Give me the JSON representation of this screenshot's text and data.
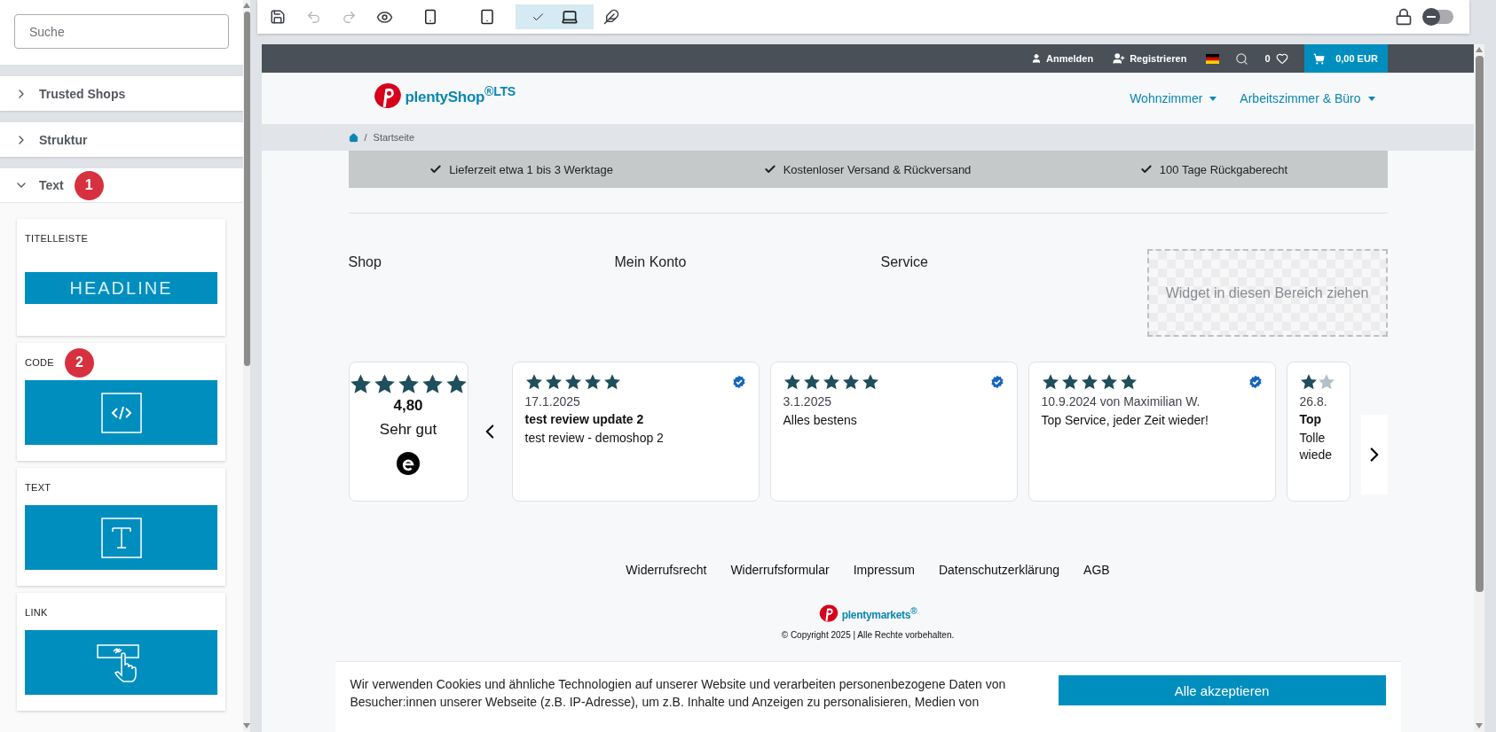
{
  "sidebar": {
    "search": {
      "placeholder": "Suche"
    },
    "sections": [
      {
        "label": "Trusted Shops",
        "expanded": false
      },
      {
        "label": "Struktur",
        "expanded": false
      },
      {
        "label": "Text",
        "expanded": true,
        "marker": "1"
      }
    ],
    "widgets": [
      {
        "label": "TITELLEISTE",
        "kind": "headline",
        "preview_text": "HEADLINE"
      },
      {
        "label": "CODE",
        "kind": "code",
        "marker": "2"
      },
      {
        "label": "TEXT",
        "kind": "text"
      },
      {
        "label": "LINK",
        "kind": "link"
      }
    ]
  },
  "toolbar": {
    "tools": [
      {
        "kind": "save",
        "disabled": false
      },
      {
        "kind": "undo",
        "disabled": true
      },
      {
        "kind": "redo",
        "disabled": true
      },
      {
        "kind": "preview",
        "disabled": false
      }
    ],
    "devices": [
      {
        "kind": "phone",
        "selected": false
      },
      {
        "kind": "tablet",
        "selected": false
      },
      {
        "kind": "desktop",
        "selected": true
      }
    ],
    "extra_tools": [
      {
        "kind": "feather",
        "disabled": false
      }
    ],
    "toggle": {
      "on": false
    }
  },
  "shop": {
    "topbar": {
      "login": "Anmelden",
      "register": "Registrieren",
      "wishlist_count": "0",
      "cart_total": "0,00 EUR"
    },
    "logo": {
      "name": "plentyShop",
      "sup": "®LTS"
    },
    "nav": [
      {
        "label": "Wohnzimmer"
      },
      {
        "label": "Arbeitszimmer & Büro"
      }
    ],
    "breadcrumb_separator": "/",
    "breadcrumb": [
      "Startseite"
    ],
    "usps": [
      "Lieferzeit etwa 1 bis 3 Werktage",
      "Kostenloser Versand & Rückversand",
      "100 Tage Rückgaberecht"
    ],
    "footer_columns": [
      "Shop",
      "Mein Konto",
      "Service"
    ],
    "drop_zone": "Widget in diesen Bereich ziehen",
    "rating": {
      "stars": 5,
      "score": "4,80",
      "label": "Sehr gut"
    },
    "reviews": [
      {
        "kind": "full",
        "stars": 5,
        "verified": true,
        "date": "17.1.2025",
        "title": "test review update 2",
        "body": "test review - demoshop 2"
      },
      {
        "kind": "full",
        "stars": 5,
        "verified": true,
        "date": "3.1.2025",
        "body": "Alles bestens"
      },
      {
        "kind": "full",
        "stars": 5,
        "verified": true,
        "date": "10.9.2024 von Maximilian W.",
        "body": "Top Service, jeder Zeit wieder!"
      },
      {
        "kind": "partial",
        "date": "26.8.",
        "title": "Top",
        "body": "Tolle wiede"
      }
    ],
    "footer_links": [
      "Widerrufsrecht",
      "Widerrufsformular",
      "Impressum",
      "Datenschutzerklärung",
      "AGB"
    ],
    "footer_logo": {
      "name": "plentymarkets",
      "sup": "®"
    },
    "copyright": "© Copyright 2025 | Alle Rechte vorbehalten.",
    "cookie": {
      "text": "Wir verwenden Cookies und ähnliche Technologien auf unserer Website und verarbeiten personenbezogene Daten von Besucher:innen unserer Webseite (z.B. IP-Adresse), um z.B. Inhalte und Anzeigen zu personalisieren, Medien von",
      "button": "Alle akzeptieren"
    }
  }
}
